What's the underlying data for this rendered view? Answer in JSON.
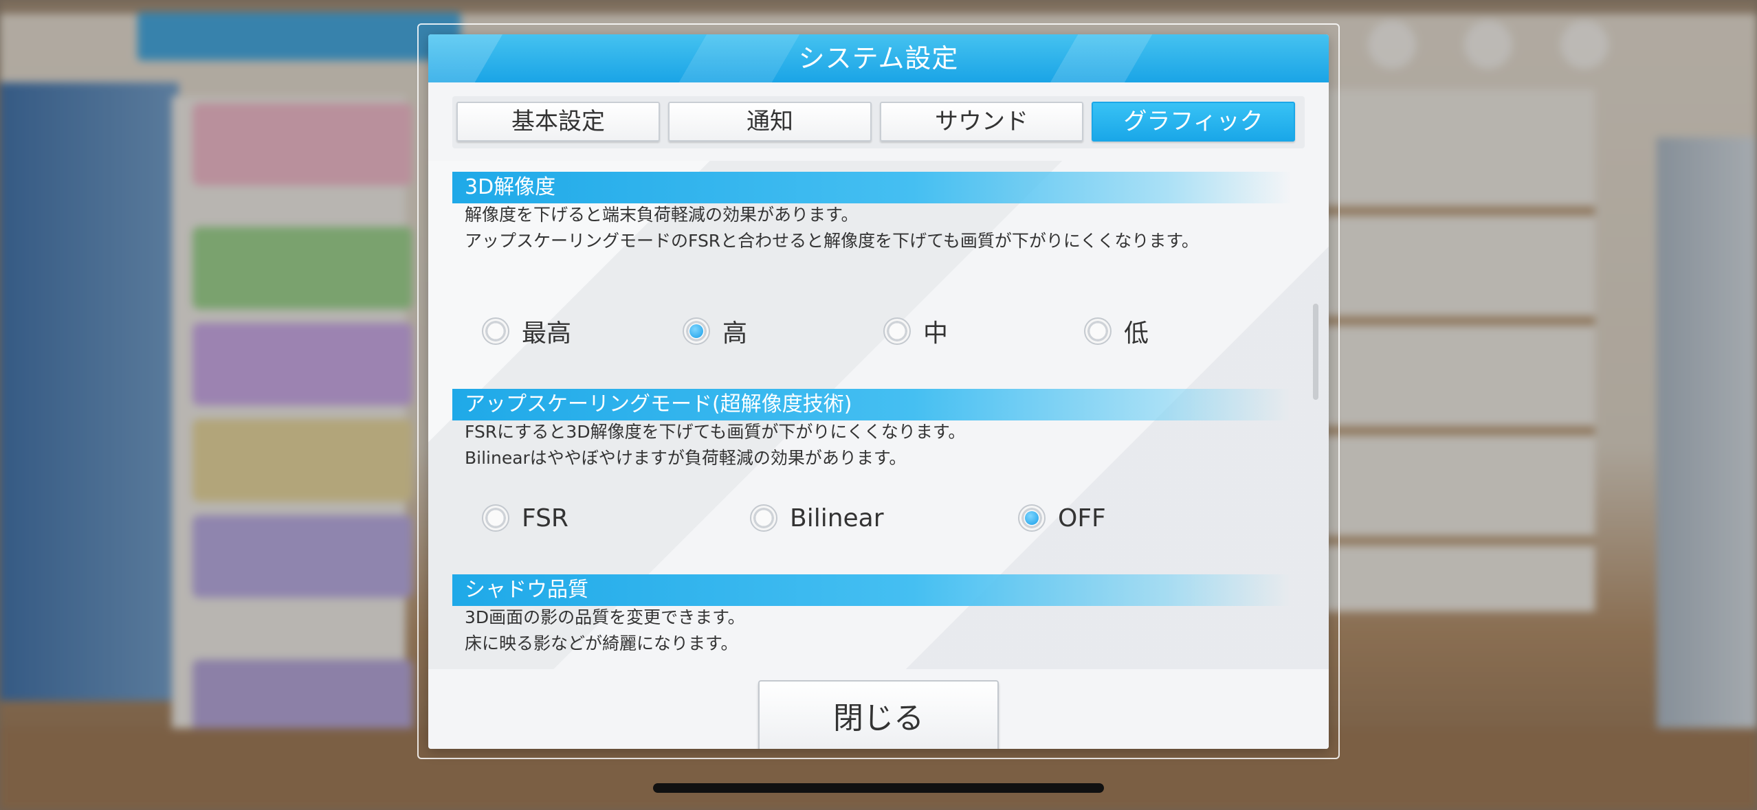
{
  "dialog": {
    "title": "システム設定",
    "tabs": [
      {
        "label": "基本設定",
        "active": false
      },
      {
        "label": "通知",
        "active": false
      },
      {
        "label": "サウンド",
        "active": false
      },
      {
        "label": "グラフィック",
        "active": true
      }
    ],
    "close_label": "閉じる"
  },
  "sections": {
    "resolution": {
      "title": "3D解像度",
      "desc_line1": "解像度を下げると端末負荷軽減の効果があります。",
      "desc_line2": "アップスケーリングモードのFSRと合わせると解像度を下げても画質が下がりにくくなります。",
      "options": [
        "最高",
        "高",
        "中",
        "低"
      ],
      "selected": "高"
    },
    "upscaling": {
      "title": "アップスケーリングモード(超解像度技術)",
      "desc_line1": "FSRにすると3D解像度を下げても画質が下がりにくくなります。",
      "desc_line2": "Bilinearはややぼやけますが負荷軽減の効果があります。",
      "options": [
        "FSR",
        "Bilinear",
        "OFF"
      ],
      "selected": "OFF"
    },
    "shadow": {
      "title": "シャドウ品質",
      "desc_line1": "3D画面の影の品質を変更できます。",
      "desc_line2": "床に映る影などが綺麗になります。"
    }
  },
  "colors": {
    "accent": "#1aa4e6",
    "radio_selected": "#1a9fe8"
  }
}
